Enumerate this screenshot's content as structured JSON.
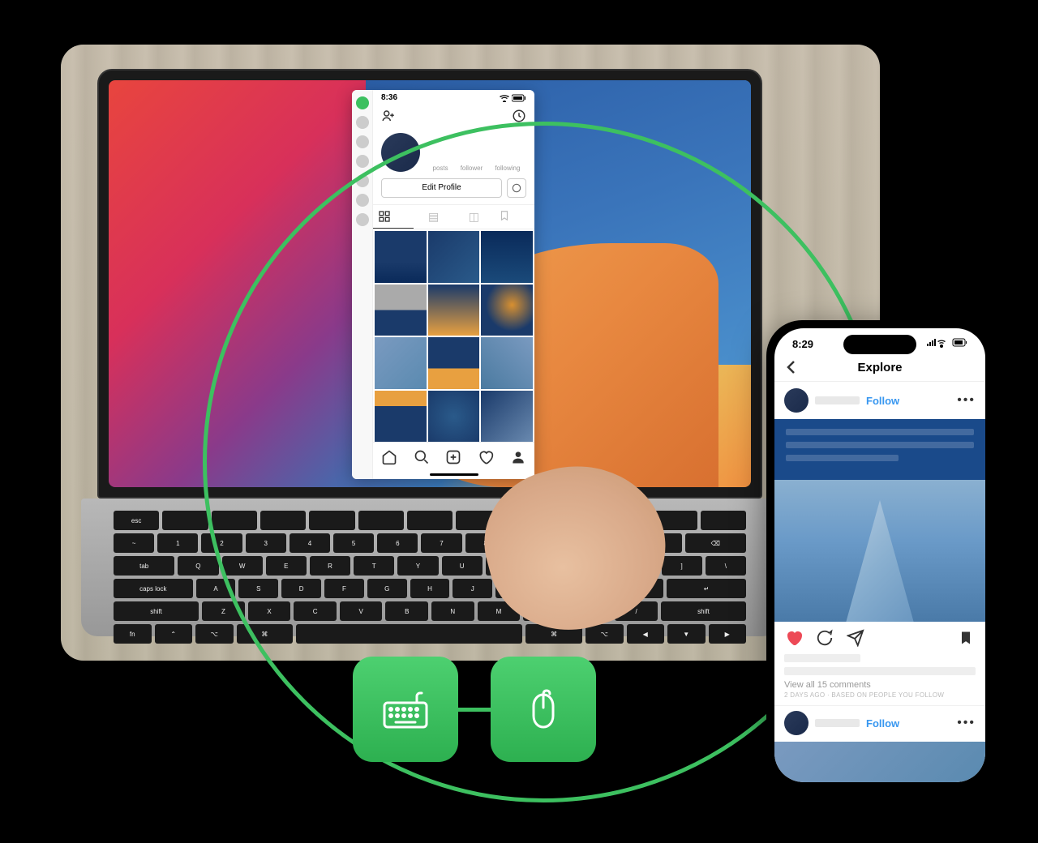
{
  "laptop_app": {
    "status_time": "8:36",
    "stats": {
      "posts": "posts",
      "follower": "follower",
      "following": "following"
    },
    "edit_profile": "Edit Profile"
  },
  "phone": {
    "status_time": "8:29",
    "header_title": "Explore",
    "follow_label": "Follow",
    "view_comments": "View all 15 comments",
    "time_meta": "2 DAYS AGO · BASED ON PEOPLE YOU FOLLOW",
    "next_follow": "Follow"
  },
  "controls": {
    "keyboard_icon": "keyboard-icon",
    "mouse_icon": "mouse-icon"
  }
}
